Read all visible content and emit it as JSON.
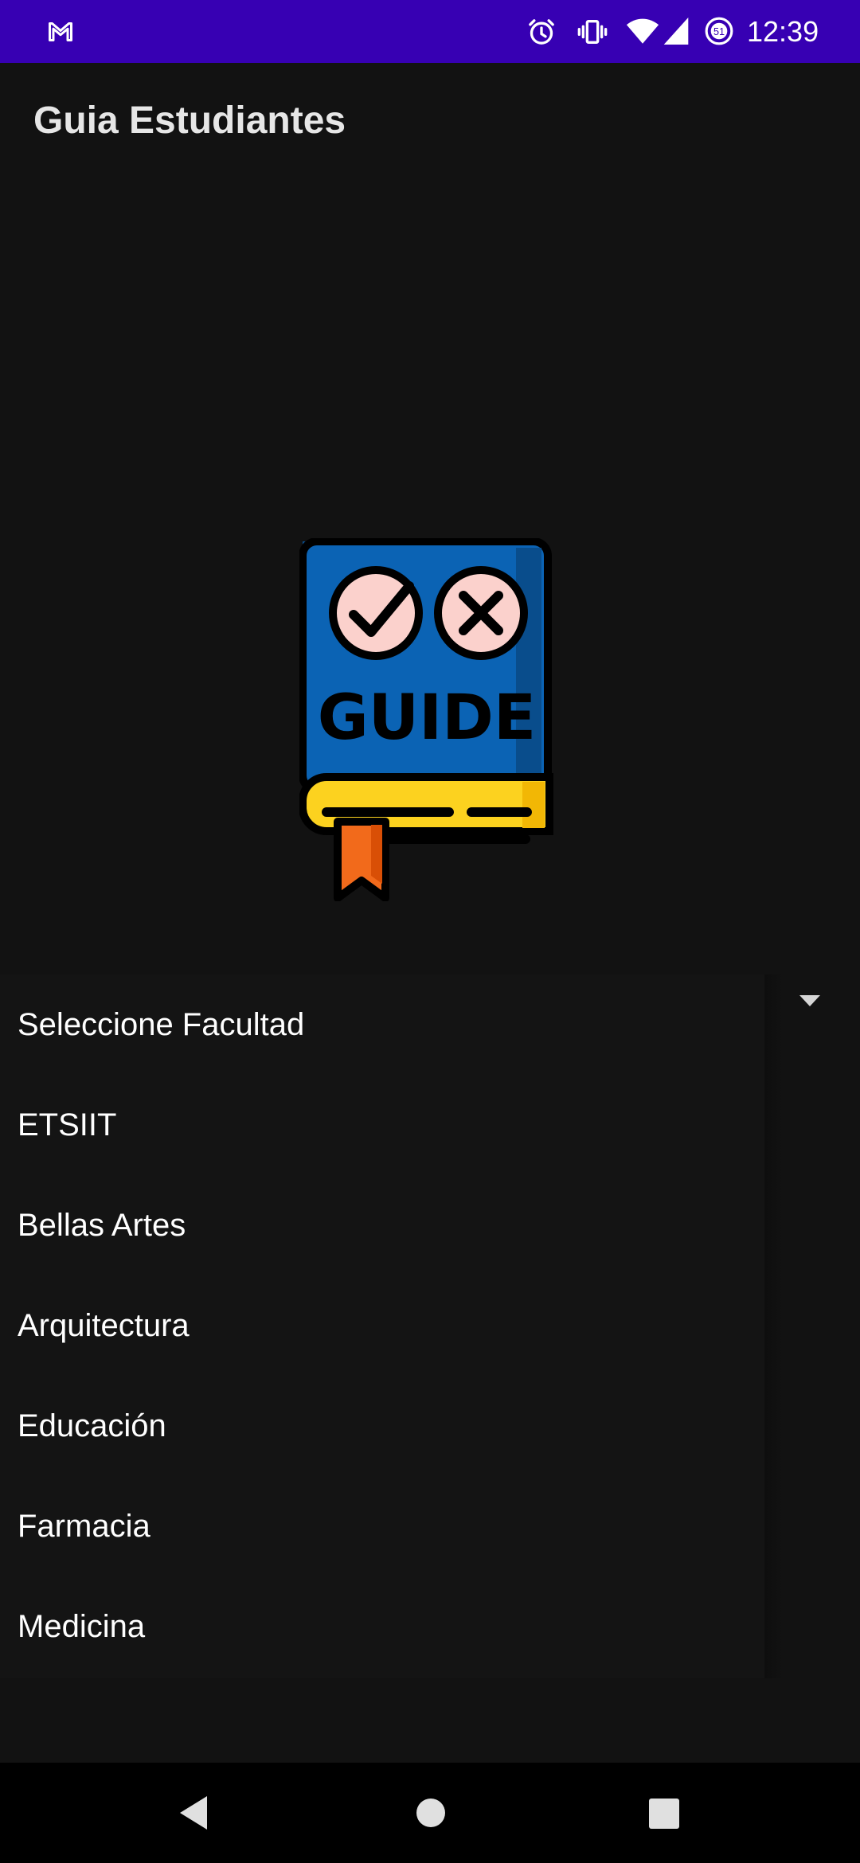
{
  "status_bar": {
    "time": "12:39",
    "icons": [
      "gmail-icon",
      "alarm-icon",
      "vibrate-icon",
      "wifi-icon",
      "cell-signal-icon",
      "data-saver-icon"
    ],
    "background": "#3700B3"
  },
  "app": {
    "title": "Guia Estudiantes"
  },
  "logo": {
    "text": "GUIDE"
  },
  "spinner": {
    "selected": "Seleccione Facultad",
    "options": [
      "Seleccione Facultad",
      "ETSIIT",
      "Bellas Artes",
      "Arquitectura",
      "Educación",
      "Farmacia",
      "Medicina"
    ]
  },
  "nav_bar": {
    "icons": [
      "back-icon",
      "home-icon",
      "recents-icon"
    ]
  }
}
